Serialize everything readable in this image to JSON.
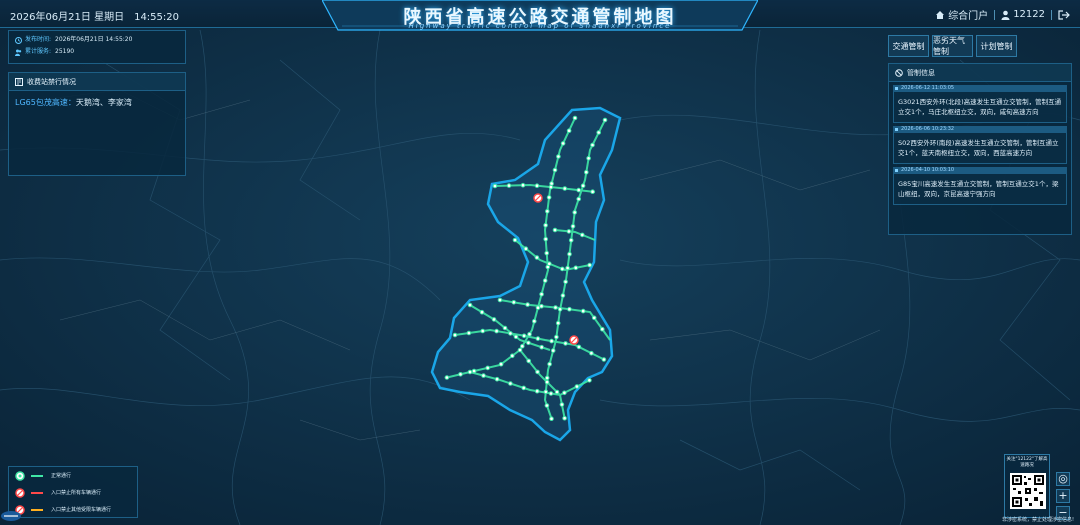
{
  "header": {
    "datetime": "2026年06月21日 星期日　14:55:20",
    "title": "陕西省高速公路交通管制地图",
    "subtitle": "Highway traffic control map of Shaanxi Province",
    "portal_label": "综合门户",
    "user_label": "12122"
  },
  "info": {
    "publish_label": "发布时间:",
    "publish_value": "2026年06月21日 14:55:20",
    "service_label": "累计服务:",
    "service_value": "25190"
  },
  "toll": {
    "title": "收费站禁行情况",
    "items": [
      {
        "road": "LG65包茂高速：",
        "stations": "天鹅湾、李家湾"
      }
    ]
  },
  "buttons": {
    "traffic": "交通管制",
    "weather": "恶劣天气管制",
    "planned": "计划管制"
  },
  "control": {
    "title": "管制信息",
    "items": [
      {
        "time": "2026-06-12 11:03:05",
        "text": "G3021西安外环(北段)高速发生互通立交管制，管制互通立交1个，马庄北枢纽立交，双向，咸旬高速方向"
      },
      {
        "time": "2026-06-06 10:23:32",
        "text": "S02西安外环(南段)高速发生互通立交管制，管制互通立交1个，蓝天南枢纽立交，双向，西蓝高速方向"
      },
      {
        "time": "2026-04-10 10:03:10",
        "text": "G85宝川高速发生互通立交管制，管制互通立交1个，梁山枢纽，双向，京昆高速宁强方向"
      }
    ]
  },
  "legend": {
    "items": [
      {
        "label": "正常通行",
        "color": "#3fe7a6"
      },
      {
        "label": "入口禁止所有车辆通行",
        "color": "#ff4a4a"
      },
      {
        "label": "入口禁止其他受限车辆通行",
        "color": "#ffb020"
      }
    ]
  },
  "qr": {
    "caption": "关注\"12122\"了解高速路况"
  },
  "zoom": {
    "locate": "◎",
    "in": "+",
    "out": "−"
  },
  "footer": {
    "text": "非涉密系统，禁止处理涉密信息!"
  },
  "colors": {
    "accent": "#2fb6ff",
    "road": "#3fe7a6",
    "border": "#1aa6e8"
  }
}
